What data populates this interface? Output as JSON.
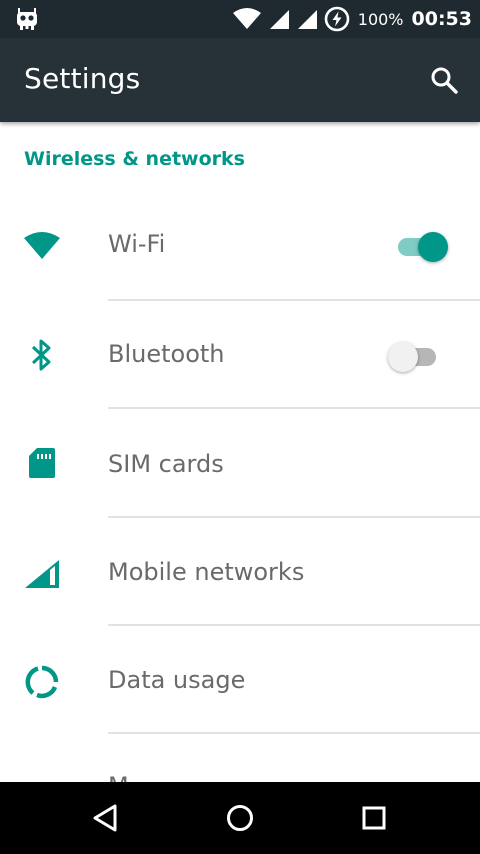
{
  "status_bar": {
    "battery_percent": "100%",
    "time": "00:53",
    "icons": [
      "android-notification-icon",
      "wifi-signal-icon",
      "cell-signal-icon",
      "cell-signal-icon",
      "battery-charging-icon"
    ]
  },
  "app_bar": {
    "title": "Settings",
    "search_icon": "search-icon"
  },
  "section": {
    "title": "Wireless & networks"
  },
  "items": [
    {
      "label": "Wi-Fi",
      "icon": "wifi-icon",
      "switch": "on"
    },
    {
      "label": "Bluetooth",
      "icon": "bluetooth-icon",
      "switch": "off"
    },
    {
      "label": "SIM cards",
      "icon": "sim-card-icon"
    },
    {
      "label": "Mobile networks",
      "icon": "signal-icon"
    },
    {
      "label": "Data usage",
      "icon": "data-usage-icon"
    },
    {
      "label": "M",
      "icon": "more-icon"
    }
  ],
  "nav_bar": {
    "icons": [
      "back-icon",
      "home-icon",
      "recents-icon"
    ]
  },
  "colors": {
    "accent": "#009688",
    "app_bar": "#263238",
    "status_bar": "#1f2a30",
    "text_secondary": "#6a6a6a",
    "divider": "#e2e2e2"
  }
}
